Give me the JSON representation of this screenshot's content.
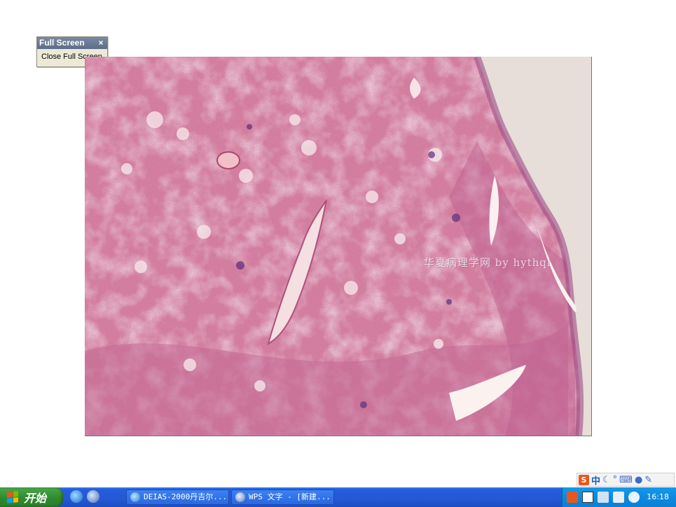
{
  "fullscreen_toolbar": {
    "title": "Full Screen",
    "close_glyph": "×",
    "close_button_label": "Close Full Screen"
  },
  "image": {
    "watermark": "华夏病理学网 by hythql"
  },
  "ime_bar": {
    "logo": "S",
    "mode": "中",
    "icons": [
      "moon-icon",
      "punctuation-icon",
      "keyboard-icon",
      "user-icon",
      "wrench-icon"
    ]
  },
  "taskbar": {
    "start_label": "开始",
    "quick_launch": [
      "ie-icon",
      "media-icon"
    ],
    "tasks": [
      {
        "label": "DEIAS-2000丹吉尔...",
        "icon": "globe-icon"
      },
      {
        "label": "WPS 文字 - [新建...",
        "icon": "wps-icon"
      }
    ],
    "tray": {
      "icons": [
        "sogou-icon",
        "help-icon",
        "network-icon",
        "volume-icon",
        "back-arrow-icon"
      ],
      "clock": "16:18"
    }
  },
  "colors": {
    "tissue_base": "#d9809f",
    "taskbar_blue": "#245edc",
    "start_green": "#2f8a2f",
    "tray_blue": "#0d8ae0"
  }
}
